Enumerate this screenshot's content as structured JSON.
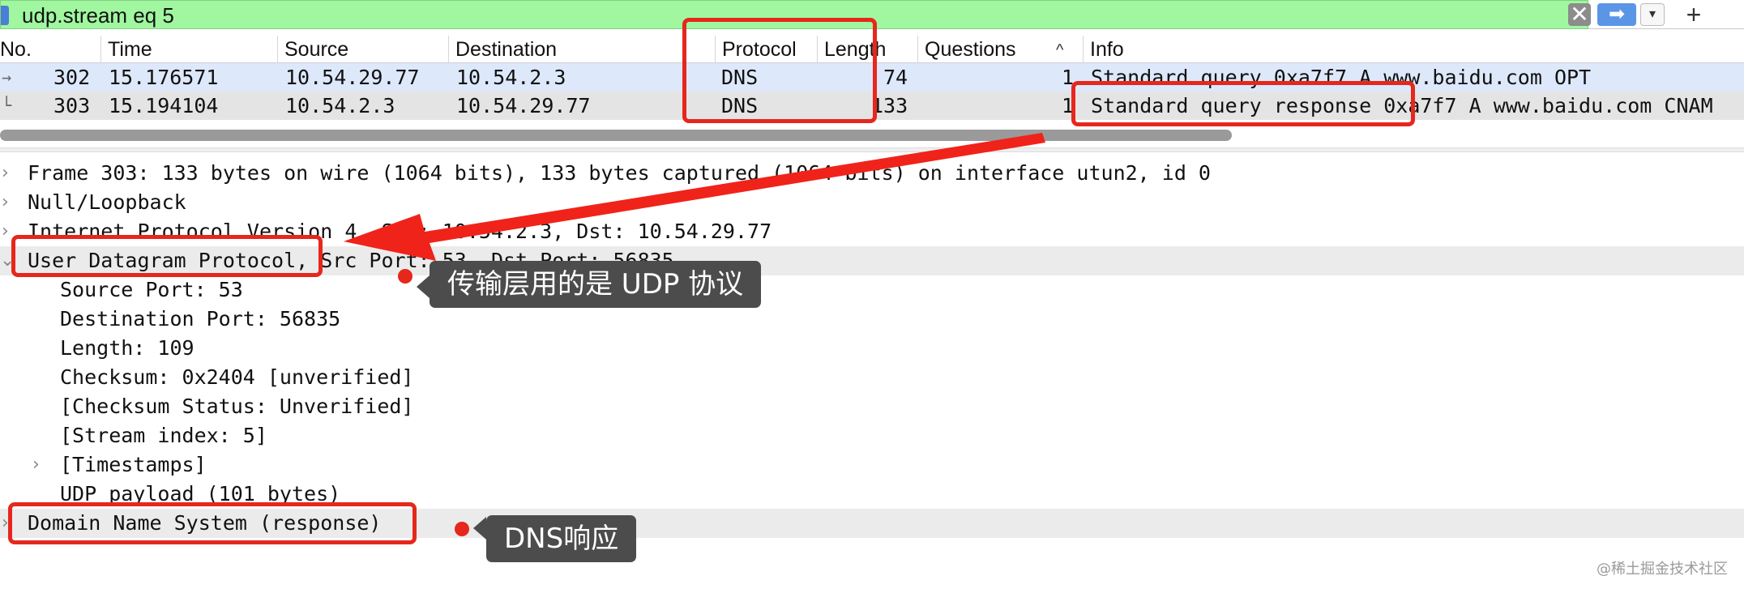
{
  "filter": {
    "text": "udp.stream eq 5",
    "clear_glyph": "✕",
    "apply_glyph": "➡",
    "dropdown_glyph": "▾",
    "add_glyph": "+"
  },
  "packet_list": {
    "columns": [
      "No.",
      "Time",
      "Source",
      "Destination",
      "Protocol",
      "Length",
      "Questions",
      "Info"
    ],
    "sort_indicator": "^",
    "rows": [
      {
        "related_glyph": "→",
        "no": "302",
        "time": "15.176571",
        "source": "10.54.29.77",
        "destination": "10.54.2.3",
        "protocol": "DNS",
        "length": "74",
        "questions": "1",
        "info": "Standard query 0xa7f7 A www.baidu.com OPT"
      },
      {
        "related_glyph": "└",
        "no": "303",
        "time": "15.194104",
        "source": "10.54.2.3",
        "destination": "10.54.29.77",
        "protocol": "DNS",
        "length": "133",
        "questions": "1",
        "info": "Standard query response 0xa7f7 A www.baidu.com CNAM"
      }
    ]
  },
  "detail_tree": {
    "collapsed_glyph": "›",
    "expanded_glyph": "⌄",
    "rows": [
      {
        "text": "Frame 303: 133 bytes on wire (1064 bits), 133 bytes captured (1064 bits) on interface utun2, id 0"
      },
      {
        "text": "Null/Loopback"
      },
      {
        "text": "Internet Protocol Version 4, Src: 10.54.2.3, Dst: 10.54.29.77"
      },
      {
        "text": "User Datagram Protocol, Src Port: 53, Dst Port: 56835"
      },
      {
        "text": "Source Port: 53"
      },
      {
        "text": "Destination Port: 56835"
      },
      {
        "text": "Length: 109"
      },
      {
        "text": "Checksum: 0x2404 [unverified]"
      },
      {
        "text": "[Checksum Status: Unverified]"
      },
      {
        "text": "[Stream index: 5]"
      },
      {
        "text": "[Timestamps]"
      },
      {
        "text": "UDP payload (101 bytes)"
      },
      {
        "text": "Domain Name System (response)"
      }
    ]
  },
  "annotations": {
    "udp_callout": "传输层用的是 UDP 协议",
    "dns_callout": "DNS响应",
    "highlight_color": "#e6271c"
  },
  "watermark": "@稀土掘金技术社区"
}
